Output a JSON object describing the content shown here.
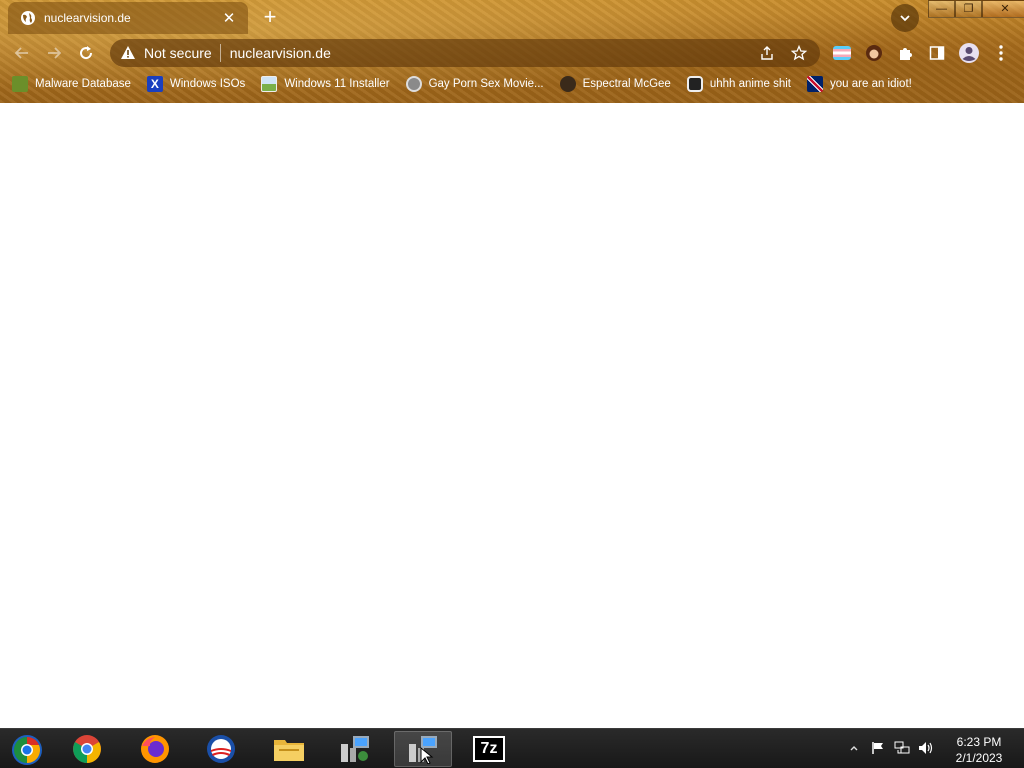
{
  "browser": {
    "tab": {
      "title": "nuclearvision.de",
      "close_glyph": "✕"
    },
    "new_tab_glyph": "+",
    "window_controls": {
      "minimize": "—",
      "maximize": "❐",
      "close": "✕"
    },
    "omnibox": {
      "security_label": "Not secure",
      "url": "nuclearvision.de"
    },
    "bookmarks": [
      {
        "label": "Malware Database",
        "icon": "folder-icon",
        "color": "#6b8f2a"
      },
      {
        "label": "Windows ISOs",
        "icon": "x-logo-icon",
        "color": "#1a3fbf"
      },
      {
        "label": "Windows 11 Installer",
        "icon": "image-icon",
        "color": "#4d8fd6"
      },
      {
        "label": "Gay Porn Sex Movie...",
        "icon": "disk-icon",
        "color": "#8a8a8a"
      },
      {
        "label": "Espectral McGee",
        "icon": "avatar-icon",
        "color": "#3a2a1a"
      },
      {
        "label": "uhhh anime shit",
        "icon": "anime-icon",
        "color": "#222222"
      },
      {
        "label": "you are an idiot!",
        "icon": "flag-icon",
        "color": "#c8102e"
      }
    ]
  },
  "taskbar": {
    "apps": [
      {
        "name": "chrome",
        "active": false
      },
      {
        "name": "firefox",
        "active": false
      },
      {
        "name": "opera",
        "active": false
      },
      {
        "name": "file-explorer",
        "active": false
      },
      {
        "name": "network-setup",
        "active": false
      },
      {
        "name": "network-setup-2",
        "active": true
      },
      {
        "name": "7zip",
        "label": "7z",
        "active": false
      }
    ],
    "clock": {
      "time": "6:23 PM",
      "date": "2/1/2023"
    }
  }
}
